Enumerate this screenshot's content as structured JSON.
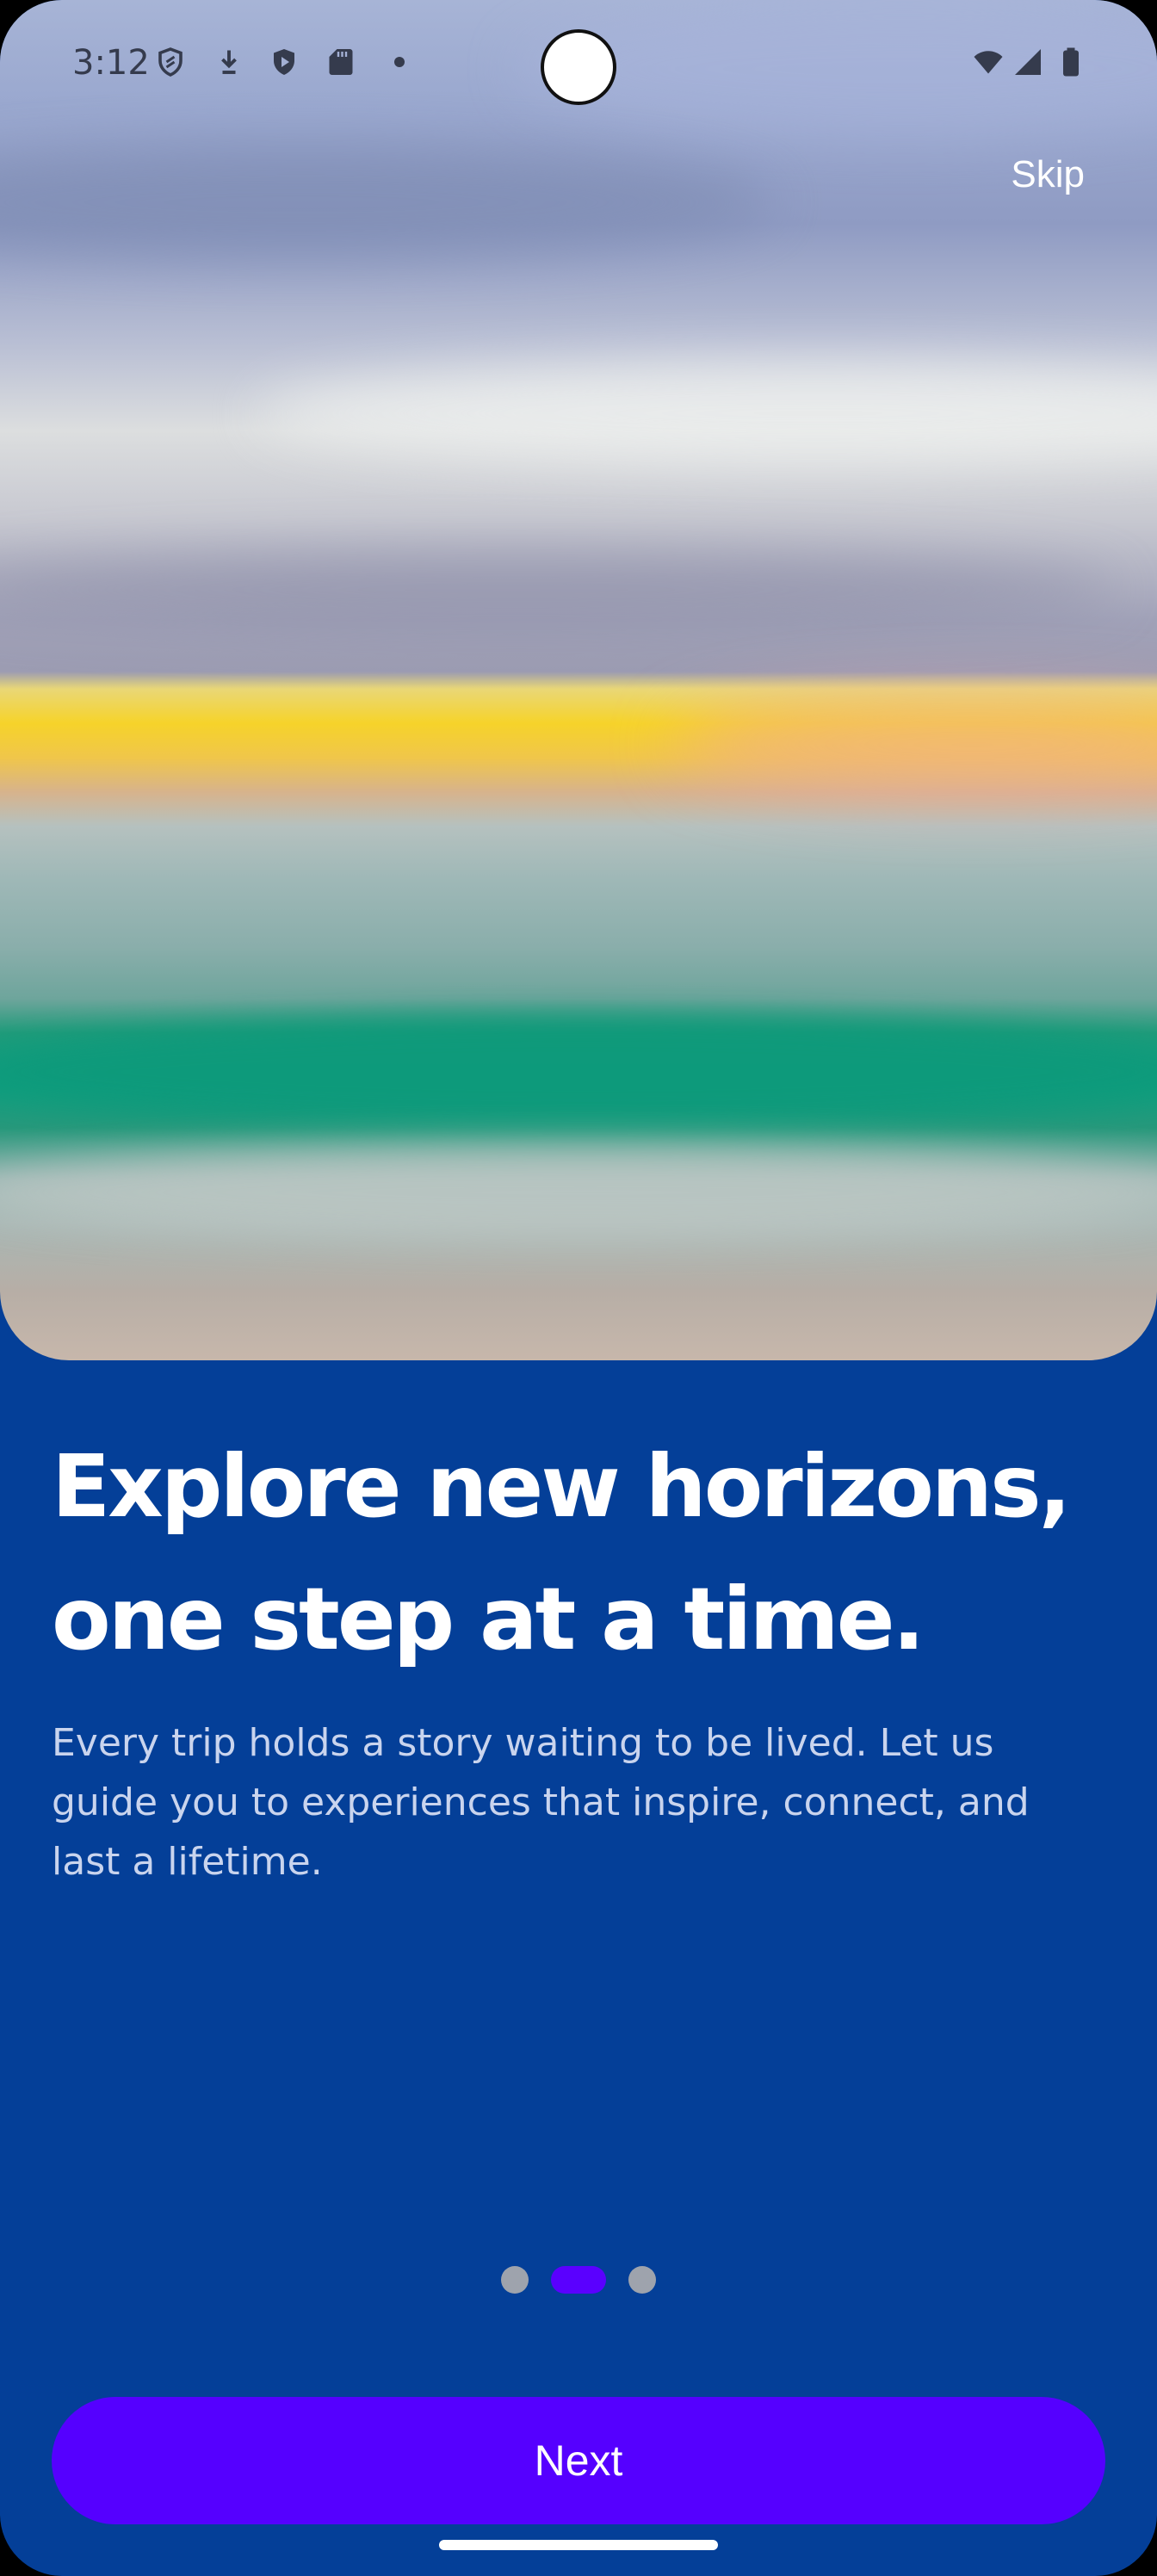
{
  "status_bar": {
    "time": "3:12",
    "icons": [
      "shield-icon",
      "download-arrow-icon",
      "play-protect-icon",
      "sd-card-icon",
      "dot-icon",
      "wifi-icon",
      "cellular-signal-icon",
      "battery-icon"
    ]
  },
  "hero": {
    "image": "ocean-sunset-image"
  },
  "skip_label": "Skip",
  "headline_line1": "Explore new horizons,",
  "headline_line2": "one step at a time.",
  "body_line1": "Every trip holds a story waiting to be lived. Let us",
  "body_line2": "guide you to experiences that inspire, connect, and",
  "body_line3": "last a lifetime.",
  "pager": {
    "total": 3,
    "active_index": 1
  },
  "next_label": "Next",
  "colors": {
    "background": "#043f98",
    "accent": "#5500ff",
    "dot_inactive": "#9ea3ad",
    "text": "#ffffff",
    "body_text": "#c9d4ee"
  }
}
